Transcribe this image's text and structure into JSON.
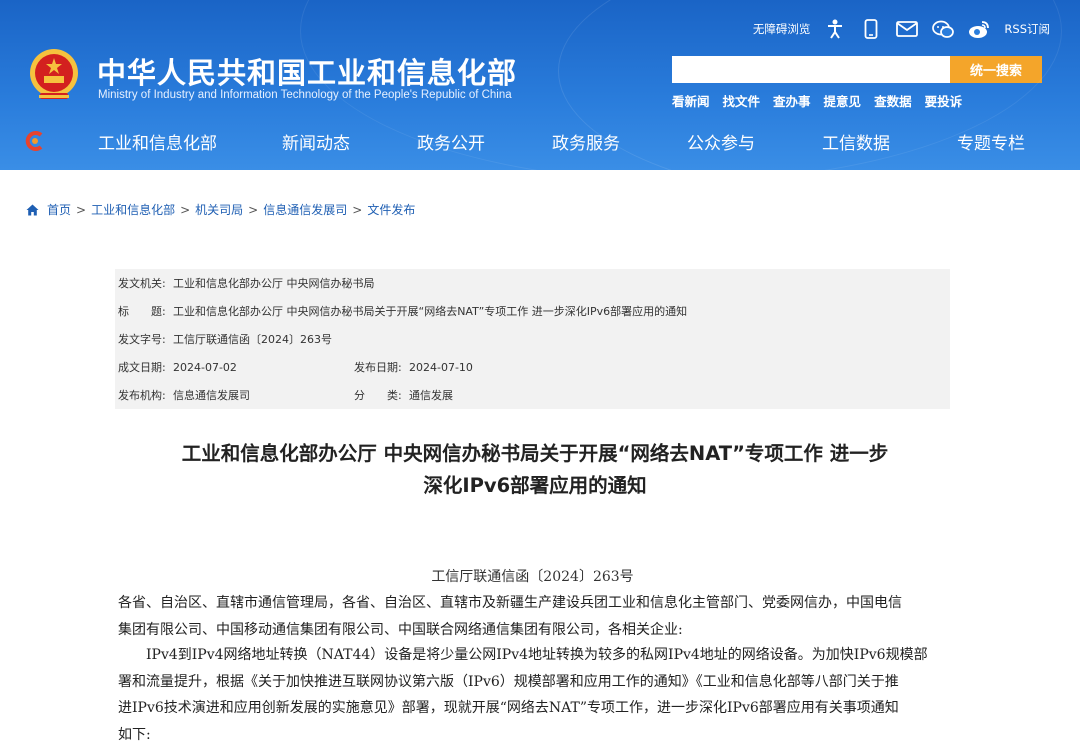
{
  "header": {
    "title": "中华人民共和国工业和信息化部",
    "subtitle": "Ministry of Industry and Information Technology of the People's Republic of China",
    "accessibility_label": "无障碍浏览",
    "rss_label": "RSS订阅",
    "icons": [
      "accessibility-icon",
      "mobile-icon",
      "mail-icon",
      "wechat-icon",
      "weibo-icon"
    ],
    "search": {
      "value": "",
      "placeholder": "",
      "button_label": "统一搜索"
    },
    "quick_links": [
      "看新闻",
      "找文件",
      "查办事",
      "提意见",
      "查数据",
      "要投诉"
    ]
  },
  "nav": {
    "items": [
      "工业和信息化部",
      "新闻动态",
      "政务公开",
      "政务服务",
      "公众参与",
      "工信数据",
      "专题专栏"
    ]
  },
  "breadcrumb": [
    "首页",
    "工业和信息化部",
    "机关司局",
    "信息通信发展司",
    "文件发布"
  ],
  "meta": {
    "issuer_label": "发文机关:",
    "issuer_value": "工业和信息化部办公厅 中央网信办秘书局",
    "title_label": "标　　题:",
    "title_value": "工业和信息化部办公厅 中央网信办秘书局关于开展“网络去NAT”专项工作 进一步深化IPv6部署应用的通知",
    "doc_no_label": "发文字号:",
    "doc_no_value": "工信厅联通信函〔2024〕263号",
    "created_label": "成文日期:",
    "created_value": "2024-07-02",
    "published_label": "发布日期:",
    "published_value": "2024-07-10",
    "org_label": "发布机构:",
    "org_value": "信息通信发展司",
    "category_label": "分　　类:",
    "category_value": "通信发展"
  },
  "document": {
    "title_line1": "工业和信息化部办公厅 中央网信办秘书局关于开展“网络去NAT”专项工作 进一步",
    "title_line2": "深化IPv6部署应用的通知",
    "doc_number": "工信厅联通信函〔2024〕263号",
    "addressees_line1": "各省、自治区、直辖市通信管理局，各省、自治区、直辖市及新疆生产建设兵团工业和信息化主管部门、党委网信办，中国电信",
    "addressees_line2": "集团有限公司、中国移动通信集团有限公司、中国联合网络通信集团有限公司，各相关企业:",
    "body_line1": "IPv4到IPv4网络地址转换（NAT44）设备是将少量公网IPv4地址转换为较多的私网IPv4地址的网络设备。为加快IPv6规模部",
    "body_line2": "署和流量提升，根据《关于加快推进互联网协议第六版（IPv6）规模部署和应用工作的通知》《工业和信息化部等八部门关于推",
    "body_line3": "进IPv6技术演进和应用创新发展的实施意见》部署，现就开展“网络去NAT”专项工作，进一步深化IPv6部署应用有关事项通知",
    "body_line4": "如下:"
  },
  "colors": {
    "header_blue": "#2a7ddc",
    "search_button": "#f4a52a",
    "link_blue": "#1f5fb3",
    "meta_bg": "#f2f2f2"
  }
}
